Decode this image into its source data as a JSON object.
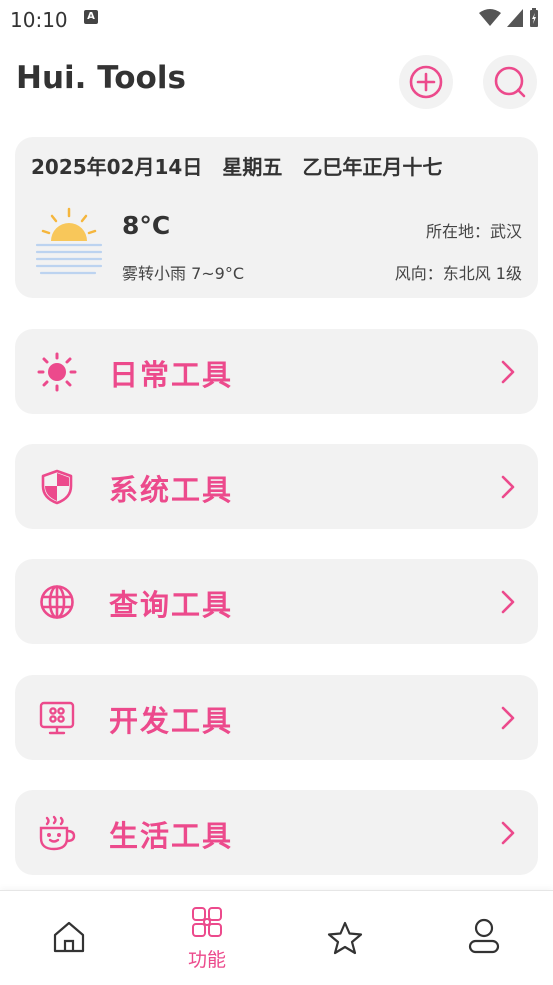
{
  "status_bar": {
    "time": "10:10",
    "notification_icon": "a-icon"
  },
  "header": {
    "title": "Hui. Tools",
    "add_icon": "plus-circle-icon",
    "search_icon": "search-icon"
  },
  "weather": {
    "date_line": "2025年02月14日　星期五　乙巳年正月十七",
    "temperature": "8°C",
    "description": "雾转小雨 7~9°C",
    "location": "所在地：武汉",
    "wind": "风向：东北风 1级",
    "icon": "sun-haze-icon"
  },
  "tools": [
    {
      "label": "日常工具",
      "icon": "sun-icon"
    },
    {
      "label": "系统工具",
      "icon": "shield-icon"
    },
    {
      "label": "查询工具",
      "icon": "globe-icon"
    },
    {
      "label": "开发工具",
      "icon": "monitor-icon"
    },
    {
      "label": "生活工具",
      "icon": "cup-icon"
    }
  ],
  "bottom_nav": [
    {
      "label": "",
      "icon": "home-icon"
    },
    {
      "label": "功能",
      "icon": "grid-icon",
      "active": true
    },
    {
      "label": "",
      "icon": "star-icon"
    },
    {
      "label": "",
      "icon": "user-icon"
    }
  ],
  "accent_color": "#ec4a8c"
}
